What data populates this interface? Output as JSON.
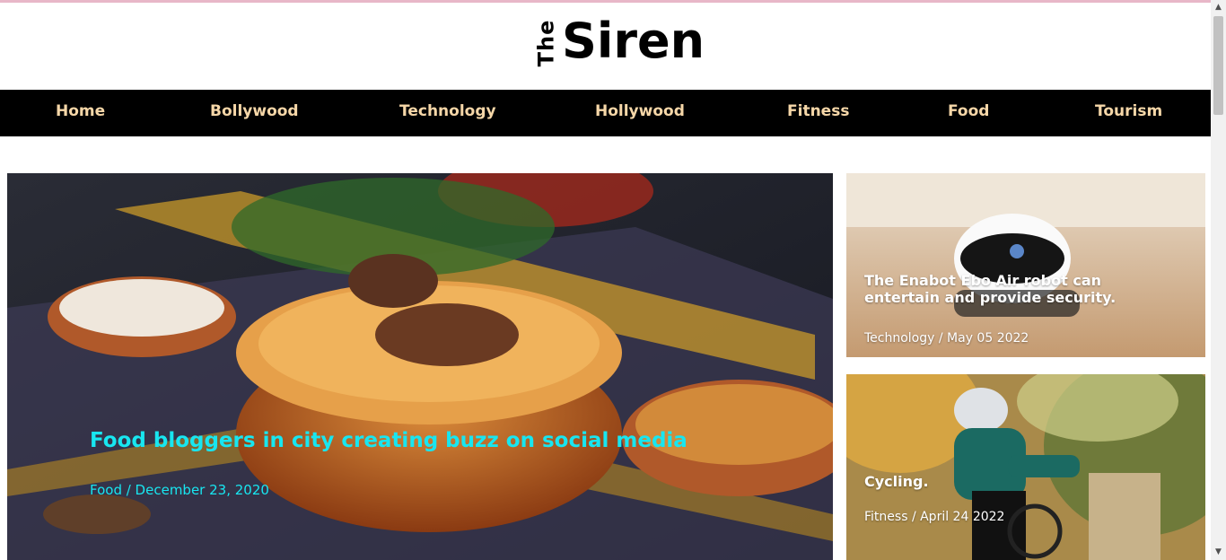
{
  "logo": {
    "the": "The",
    "name": "Siren"
  },
  "nav": [
    {
      "label": "Home",
      "name": "nav-home"
    },
    {
      "label": "Bollywood",
      "name": "nav-bollywood"
    },
    {
      "label": "Technology",
      "name": "nav-technology"
    },
    {
      "label": "Hollywood",
      "name": "nav-hollywood"
    },
    {
      "label": "Fitness",
      "name": "nav-fitness"
    },
    {
      "label": "Food",
      "name": "nav-food"
    },
    {
      "label": "Tourism",
      "name": "nav-tourism"
    }
  ],
  "hero": {
    "title": "Food bloggers in city creating buzz on social media",
    "meta": "Food / December 23, 2020"
  },
  "side_cards": [
    {
      "title": "The Enabot Ebo Air robot can entertain and provide security.",
      "meta": "Technology / May 05 2022"
    },
    {
      "title": "Cycling.",
      "meta": "Fitness / April 24 2022"
    }
  ],
  "colors": {
    "nav_bg": "#000000",
    "nav_text": "#f6d7a8",
    "hero_accent": "#18e6f0"
  },
  "icons": {
    "scroll_up": "scroll-up-arrow-icon",
    "scroll_down": "scroll-down-arrow-icon"
  }
}
